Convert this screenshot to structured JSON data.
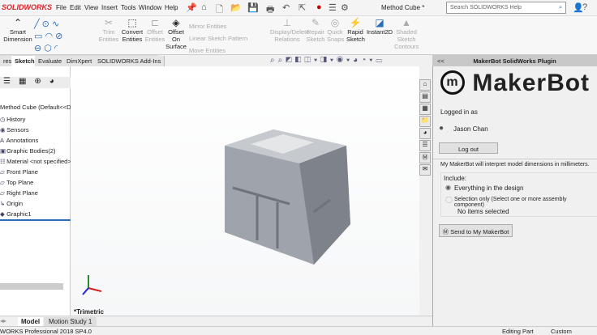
{
  "app": {
    "logo": "SOLIDWORKS",
    "menu": [
      "File",
      "Edit",
      "View",
      "Insert",
      "Tools",
      "Window",
      "Help"
    ],
    "document_title": "Method Cube *",
    "search_placeholder": "Search SOLIDWORKS Help"
  },
  "ribbon": {
    "smart_dimension": "Smart Dimension",
    "trim": "Trim Entities",
    "convert": "Convert Entities",
    "offset": "Offset Entities",
    "offset_surface": "Offset On Surface",
    "mirror": "Mirror Entities",
    "linear_pattern": "Linear Sketch Pattern",
    "move": "Move Entities",
    "display_delete": "Display/Delete Relations",
    "repair": "Repair Sketch",
    "quick_snaps": "Quick Snaps",
    "rapid_sketch": "Rapid Sketch",
    "instant2d": "Instant2D",
    "shaded": "Shaded Sketch Contours"
  },
  "tabs": [
    "res",
    "Sketch",
    "Evaluate",
    "DimXpert",
    "SOLIDWORKS Add-Ins"
  ],
  "tree": {
    "root": "Method Cube  (Default<<De",
    "items": [
      "History",
      "Sensors",
      "Annotations",
      "Graphic Bodies(2)",
      "Material <not specified>",
      "Front Plane",
      "Top Plane",
      "Right Plane",
      "Origin",
      "Graphic1"
    ]
  },
  "viewport": {
    "view_label": "*Trimetric"
  },
  "plugin": {
    "title": "MakerBot SolidWorks Plugin",
    "collapse": "<<",
    "brand": "MakerBot",
    "logged_in_as": "Logged in as",
    "user": "Jason Chan",
    "logout": "Log out",
    "info": "My MakerBot will interpret model dimensions in millimeters.",
    "include": "Include:",
    "opt_everything": "Everything in the design",
    "opt_selection": "Selection only (Select one or more assembly component)",
    "no_items": "No items selected",
    "send": "Send to My MakerBot",
    "selected_option": "Everything in the design"
  },
  "bottom_tabs": [
    "Model",
    "Motion Study 1"
  ],
  "status": {
    "version": "WORKS Professional 2018 SP4.0",
    "mode": "Editing Part",
    "units": "Custom"
  }
}
